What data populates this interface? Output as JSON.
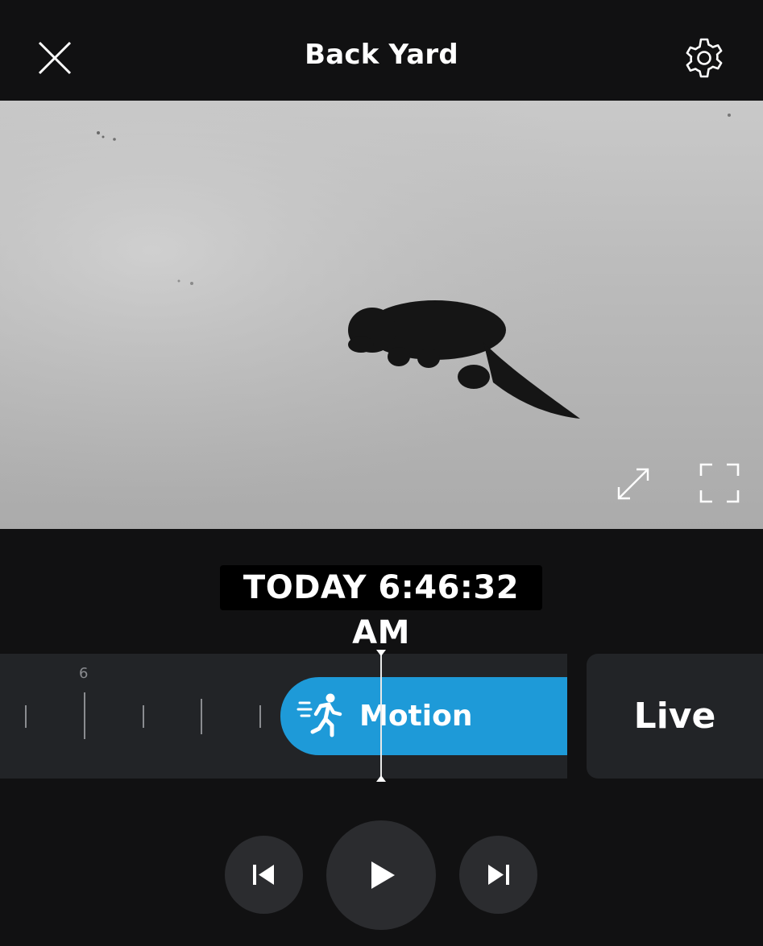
{
  "header": {
    "title": "Back Yard",
    "close_icon": "close-icon",
    "settings_icon": "gear-icon"
  },
  "video": {
    "expand_icon": "expand-arrows-icon",
    "fullscreen_icon": "fullscreen-icon"
  },
  "timestamp": "TODAY 6:46:32 AM",
  "timeline": {
    "tick_label": "6",
    "event": {
      "label": "Motion",
      "icon": "running-person-icon",
      "color": "#1e9ad8"
    }
  },
  "live_button": "Live",
  "controls": {
    "previous_icon": "skip-previous-icon",
    "play_icon": "play-icon",
    "next_icon": "skip-next-icon"
  }
}
